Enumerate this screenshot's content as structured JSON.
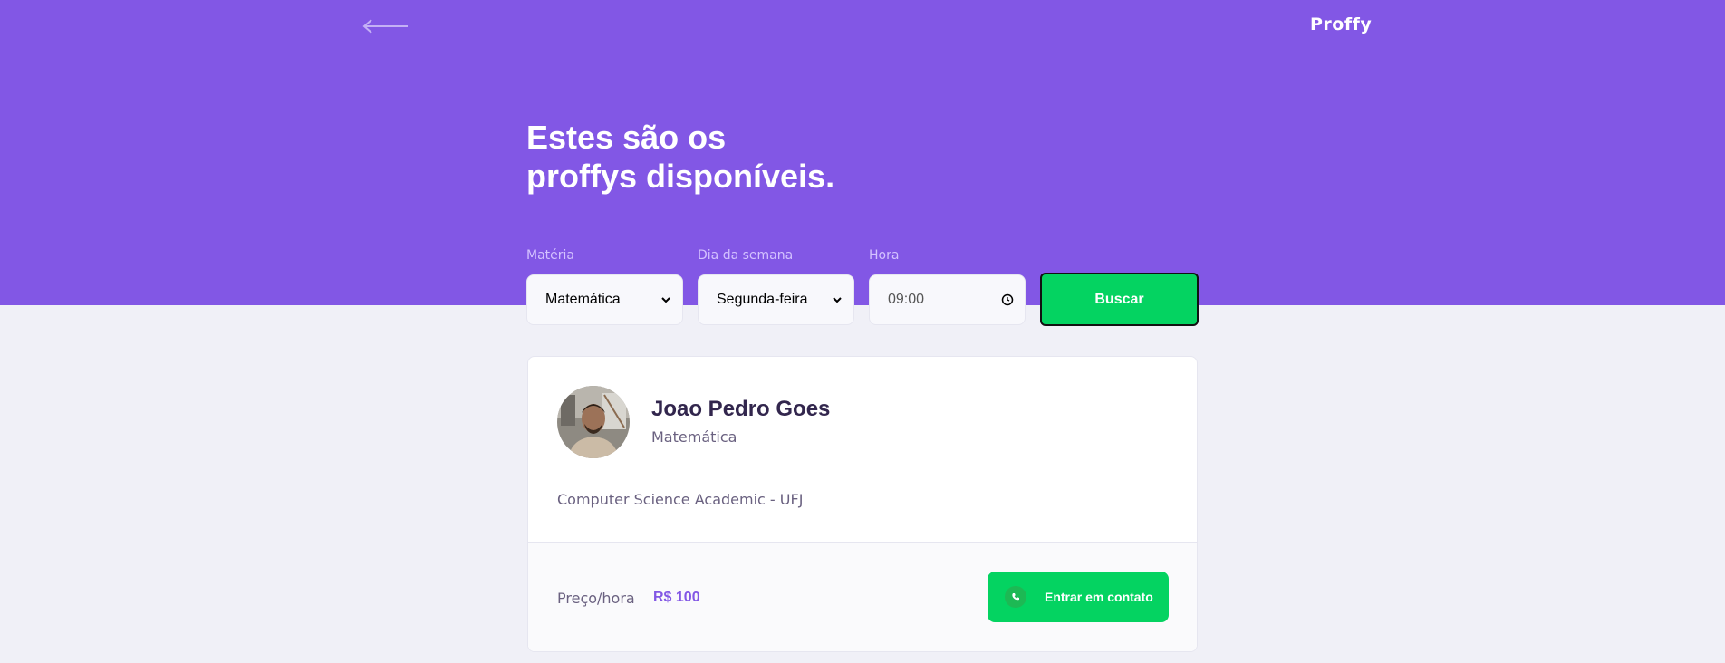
{
  "header": {
    "logo": "Proffy",
    "title_line1": "Estes são os",
    "title_line2": "proffys disponíveis."
  },
  "filters": {
    "subject_label": "Matéria",
    "subject_value": "Matemática",
    "weekday_label": "Dia da semana",
    "weekday_value": "Segunda-feira",
    "time_label": "Hora",
    "time_value": "09:00",
    "search_button": "Buscar"
  },
  "teachers": [
    {
      "name": "Joao Pedro Goes",
      "subject": "Matemática",
      "bio": "Computer Science Academic - UFJ",
      "price_label": "Preço/hora",
      "price": "R$ 100",
      "contact_button": "Entrar em contato"
    }
  ],
  "colors": {
    "primary": "#8257E5",
    "secondary": "#04D361",
    "background": "#F0F0F7",
    "title_text": "#32264D",
    "body_text": "#6A6180"
  },
  "icons": {
    "back": "arrow-left-icon",
    "dropdown": "chevron-down-icon",
    "clock": "clock-icon",
    "contact": "whatsapp-icon"
  }
}
